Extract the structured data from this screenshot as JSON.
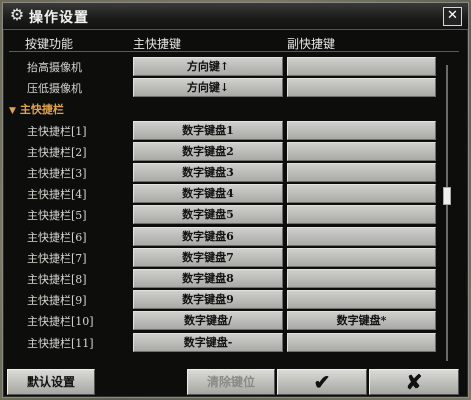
{
  "window": {
    "title": "操作设置",
    "close_glyph": "✕"
  },
  "columns": {
    "function": "按键功能",
    "primary": "主快捷键",
    "secondary": "副快捷键"
  },
  "rows": [
    {
      "label": "抬高摄像机",
      "primary": "方向键↑",
      "secondary": ""
    },
    {
      "label": "压低摄像机",
      "primary": "方向键↓",
      "secondary": ""
    },
    {
      "label": "主快捷栏",
      "primary": "",
      "secondary": "",
      "section": true
    },
    {
      "label": "主快捷栏[1]",
      "primary": "数字键盘1",
      "secondary": ""
    },
    {
      "label": "主快捷栏[2]",
      "primary": "数字键盘2",
      "secondary": ""
    },
    {
      "label": "主快捷栏[3]",
      "primary": "数字键盘3",
      "secondary": ""
    },
    {
      "label": "主快捷栏[4]",
      "primary": "数字键盘4",
      "secondary": ""
    },
    {
      "label": "主快捷栏[5]",
      "primary": "数字键盘5",
      "secondary": ""
    },
    {
      "label": "主快捷栏[6]",
      "primary": "数字键盘6",
      "secondary": ""
    },
    {
      "label": "主快捷栏[7]",
      "primary": "数字键盘7",
      "secondary": ""
    },
    {
      "label": "主快捷栏[8]",
      "primary": "数字键盘8",
      "secondary": ""
    },
    {
      "label": "主快捷栏[9]",
      "primary": "数字键盘9",
      "secondary": ""
    },
    {
      "label": "主快捷栏[10]",
      "primary": "数字键盘/",
      "secondary": "数字键盘*"
    },
    {
      "label": "主快捷栏[11]",
      "primary": "数字键盘-",
      "secondary": ""
    }
  ],
  "buttons": {
    "default": "默认设置",
    "clear": "清除键位",
    "ok_glyph": "✔",
    "cancel_glyph": "✘"
  },
  "icons": {
    "title": "gear-icon",
    "close": "close-icon",
    "section": "triangle-down-icon",
    "ok": "checkmark-icon",
    "cancel": "cross-icon"
  },
  "colors": {
    "section_accent": "#e0a24a",
    "background": "#0d0d0c"
  }
}
